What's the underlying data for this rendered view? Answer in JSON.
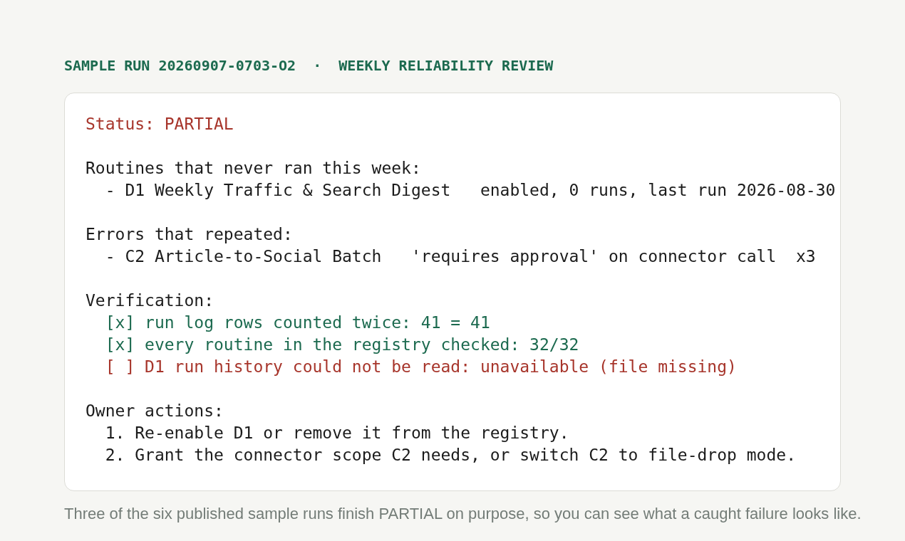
{
  "header": {
    "title": "SAMPLE RUN 20260907-0703-O2  ·  WEEKLY RELIABILITY REVIEW"
  },
  "report": {
    "status": {
      "text": "Status: PARTIAL",
      "kind": "partial"
    },
    "sections": [
      {
        "kind": "bullets",
        "heading": "Routines that never ran this week:",
        "items": [
          {
            "text": "- D1 Weekly Traffic & Search Digest   enabled, 0 runs, last run 2026-08-30"
          }
        ]
      },
      {
        "kind": "bullets",
        "heading": "Errors that repeated:",
        "items": [
          {
            "text": "- C2 Article-to-Social Batch   'requires approval' on connector call  x3"
          }
        ]
      },
      {
        "kind": "checks",
        "heading": "Verification:",
        "items": [
          {
            "text": "[x] run log rows counted twice: 41 = 41",
            "checked": true
          },
          {
            "text": "[x] every routine in the registry checked: 32/32",
            "checked": true
          },
          {
            "text": "[ ] D1 run history could not be read: unavailable (file missing)",
            "checked": false
          }
        ]
      },
      {
        "kind": "numbered",
        "heading": "Owner actions:",
        "items": [
          {
            "text": "1. Re-enable D1 or remove it from the registry."
          },
          {
            "text": "2. Grant the connector scope C2 needs, or switch C2 to file-drop mode."
          }
        ]
      }
    ]
  },
  "footer": "Three of the six published sample runs finish PARTIAL on purpose, so you can see what a caught failure looks like."
}
